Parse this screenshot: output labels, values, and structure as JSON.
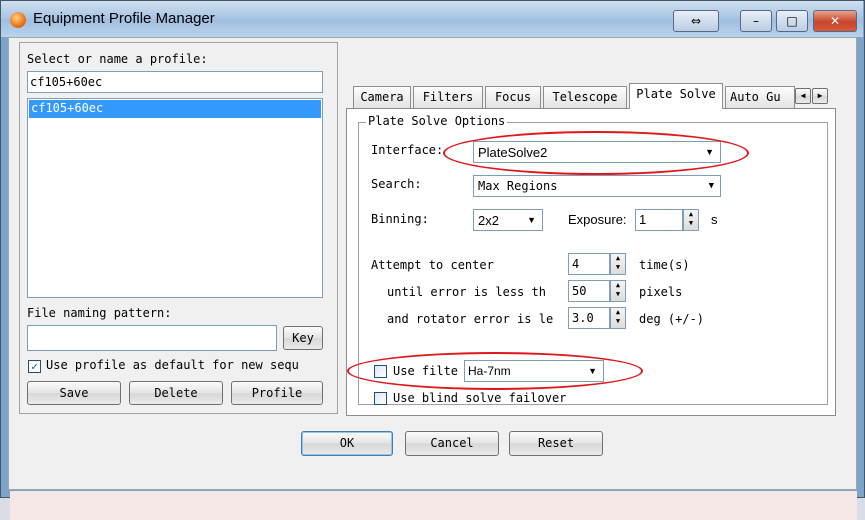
{
  "window": {
    "title": "Equipment Profile Manager",
    "titlebar_buttons": [
      "⇔",
      "–",
      "□",
      "✕"
    ]
  },
  "profile": {
    "select_label": "Select or name a profile:",
    "name_value": "cf105+60ec",
    "list_items": [
      "cf105+60ec"
    ],
    "file_naming_label": "File naming pattern:",
    "file_naming_value": "",
    "key_button": "Key",
    "default_checkbox_label": "Use profile as default for new sequ",
    "default_checked": true,
    "save_button": "Save",
    "delete_button": "Delete",
    "profile_button": "Profile"
  },
  "tabs": [
    "Camera",
    "Filters",
    "Focus",
    "Telescope",
    "Plate Solve",
    "Auto Gu"
  ],
  "active_tab": "Plate Solve",
  "plate_solve": {
    "group_title": "Plate Solve Options",
    "interface_label": "Interface:",
    "interface_value": "PlateSolve2",
    "search_label": "Search:",
    "search_value": "Max Regions",
    "binning_label": "Binning:",
    "binning_value": "2x2",
    "exposure_label": "Exposure:",
    "exposure_value": "1",
    "exposure_unit": "s",
    "attempt_label": "Attempt to center",
    "attempt_value": "4",
    "attempt_unit": "time(s)",
    "error_label": "until error is less th",
    "error_value": "50",
    "error_unit": "pixels",
    "rotator_label": "and rotator error is le",
    "rotator_value": "3.0",
    "rotator_unit": "deg (+/-)",
    "use_filter_label": "Use filte",
    "use_filter_checked": false,
    "filter_value": "Ha-7nm",
    "blind_solve_label": "Use blind solve failover",
    "blind_solve_checked": false
  },
  "bottom_buttons": {
    "ok": "OK",
    "cancel": "Cancel",
    "reset": "Reset"
  },
  "annotation_color": "#e0181b"
}
